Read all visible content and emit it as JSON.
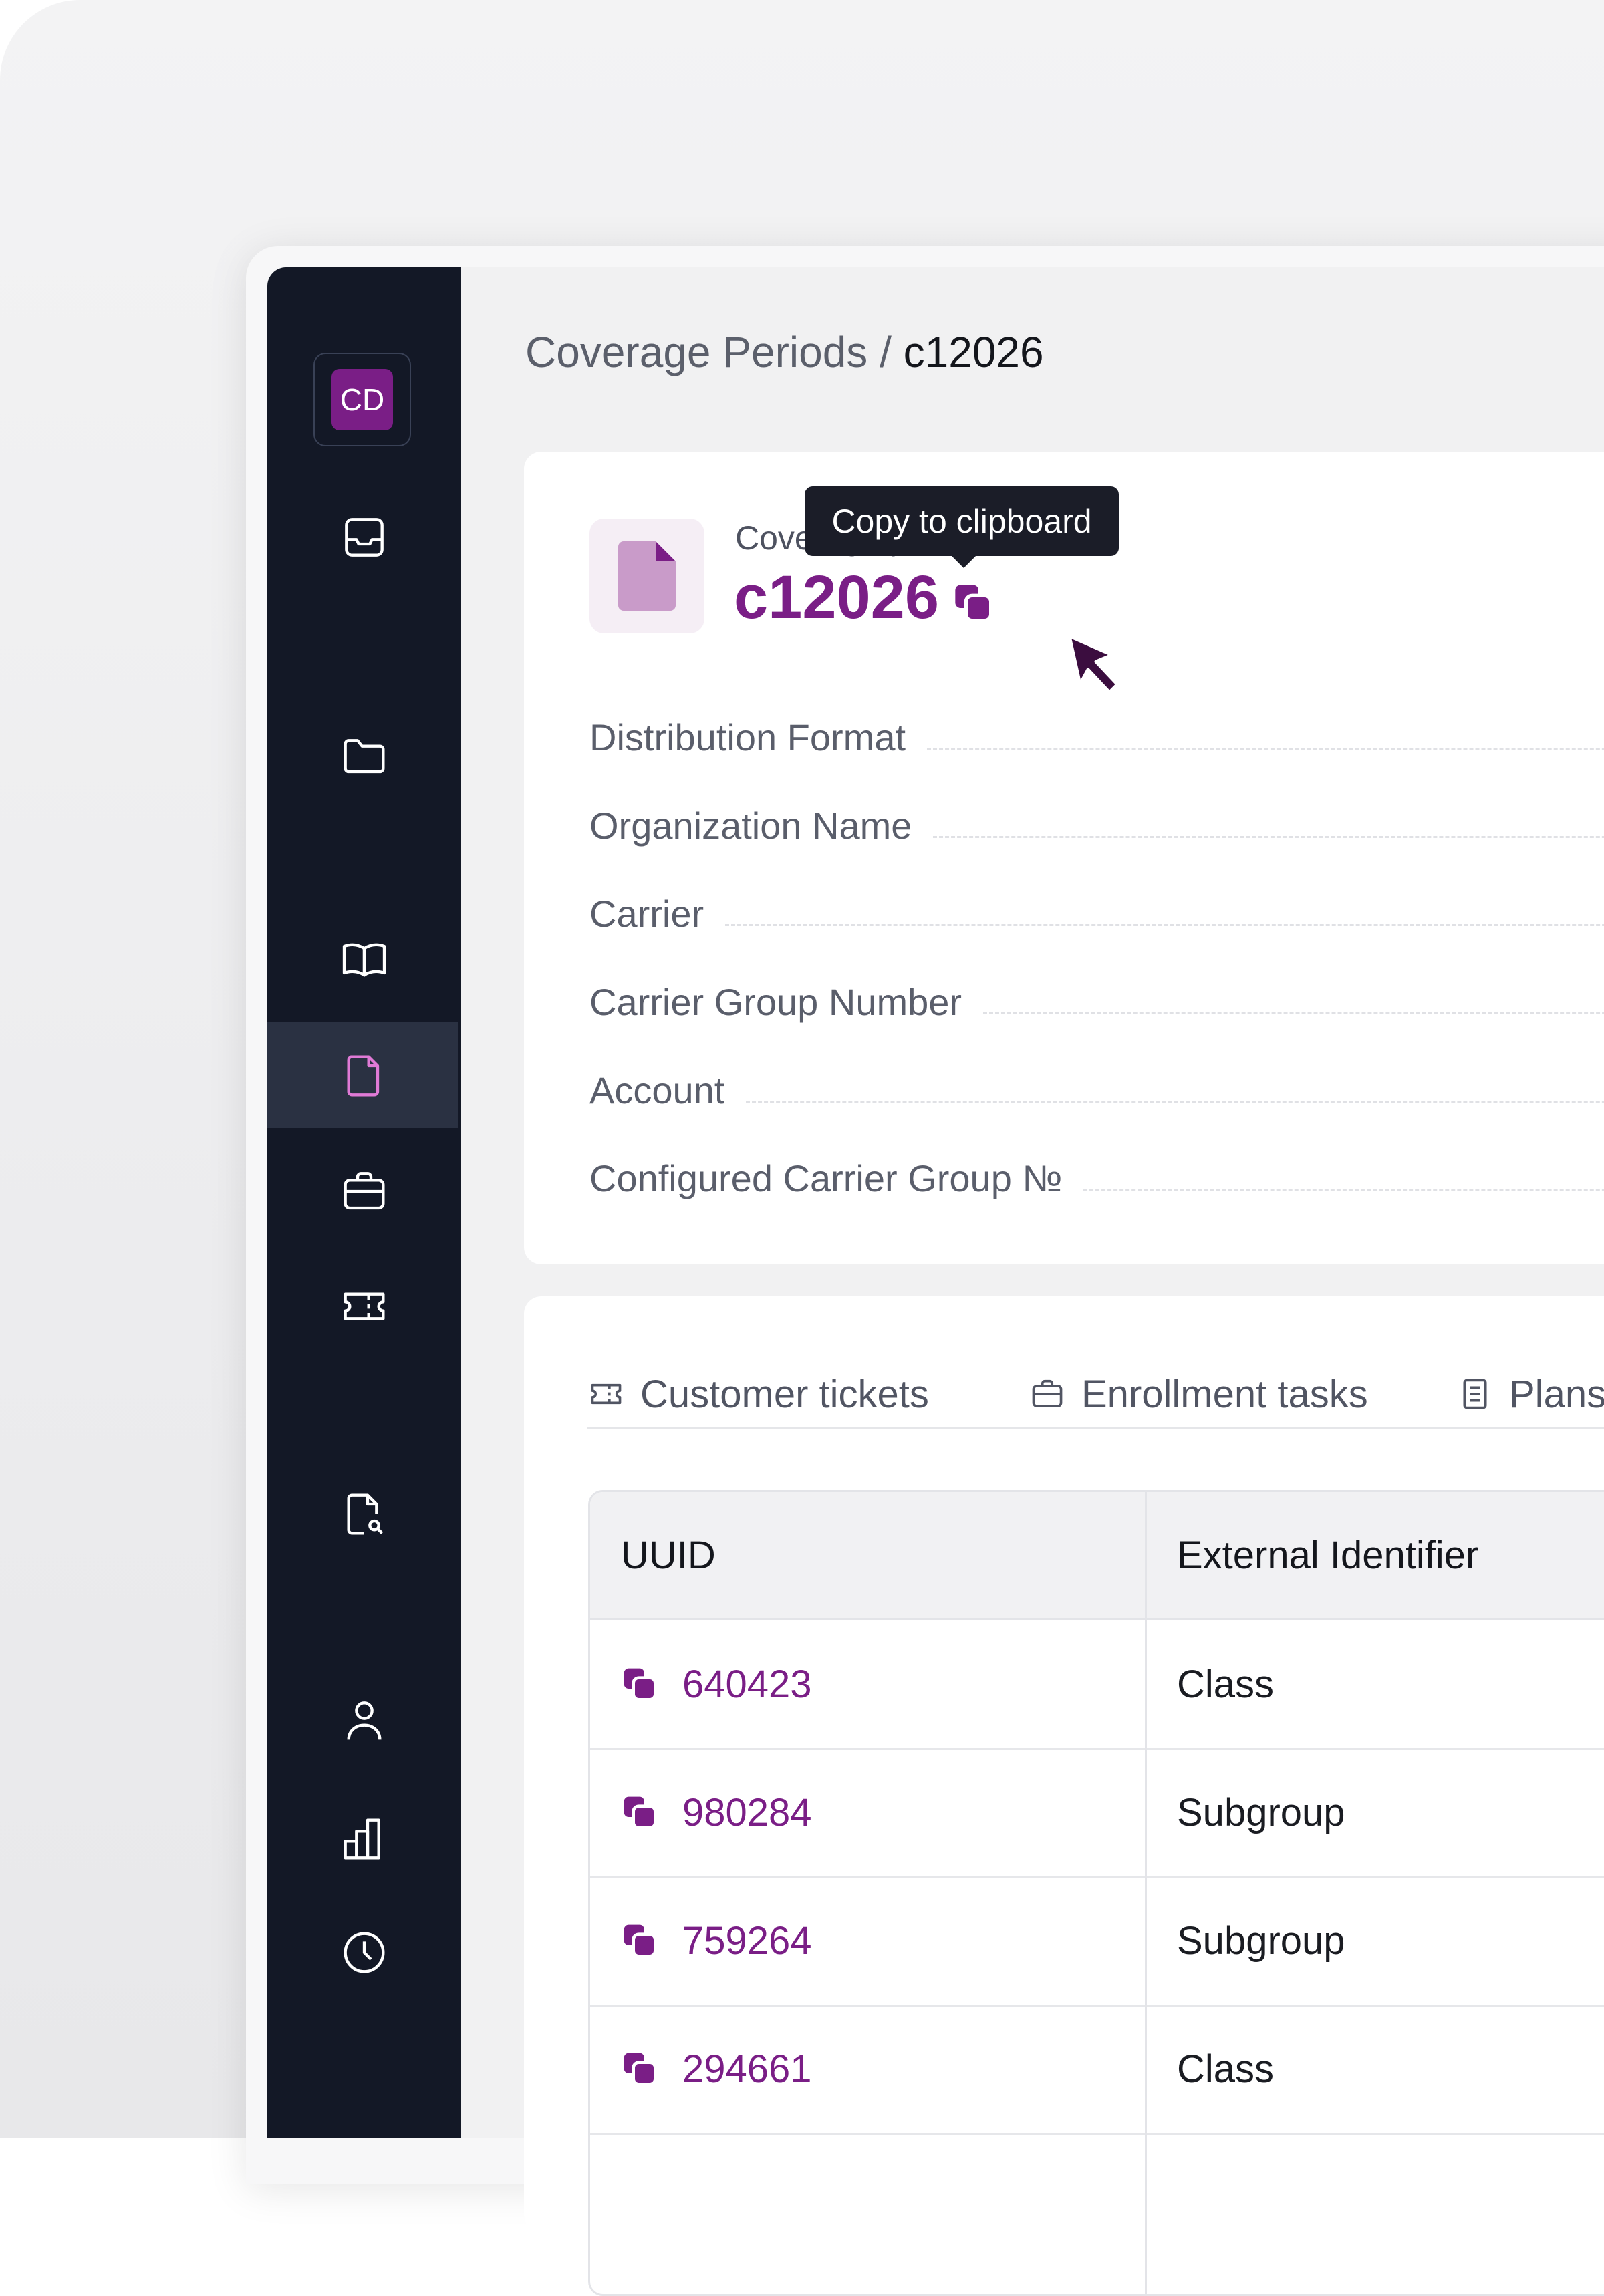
{
  "sidebar": {
    "logo_text": "CD",
    "icons": [
      "inbox-icon",
      "folder-icon",
      "book-icon",
      "document-icon",
      "briefcase-icon",
      "ticket-icon",
      "document-search-icon",
      "user-icon",
      "bar-chart-icon",
      "clock-icon"
    ],
    "active": "document-icon"
  },
  "breadcrumb": {
    "parent": "Coverage Periods",
    "separator": " / ",
    "current": "c12026"
  },
  "details": {
    "uuid_label": "Coverage period UUID",
    "uuid_value": "c12026",
    "tooltip": "Copy to clipboard",
    "fields": [
      {
        "label": "Distribution Format"
      },
      {
        "label": "Organization Name"
      },
      {
        "label": "Carrier"
      },
      {
        "label": "Carrier Group Number"
      },
      {
        "label": "Account"
      },
      {
        "label": "Configured Carrier Group №"
      }
    ]
  },
  "tabs": [
    {
      "label": "Customer tickets",
      "icon": "ticket-icon"
    },
    {
      "label": "Enrollment tasks",
      "icon": "briefcase-icon"
    },
    {
      "label": "Plans",
      "icon": "document-list-icon"
    }
  ],
  "table": {
    "headers": [
      "UUID",
      "External Identifier"
    ],
    "rows": [
      {
        "uuid": "640423",
        "external": "Class"
      },
      {
        "uuid": "980284",
        "external": "Subgroup"
      },
      {
        "uuid": "759264",
        "external": "Subgroup"
      },
      {
        "uuid": "294661",
        "external": "Class"
      }
    ]
  },
  "colors": {
    "accent": "#7a1e86",
    "sidebar": "#131826",
    "active_item": "#2a3142",
    "active_icon": "#e07ad6"
  }
}
